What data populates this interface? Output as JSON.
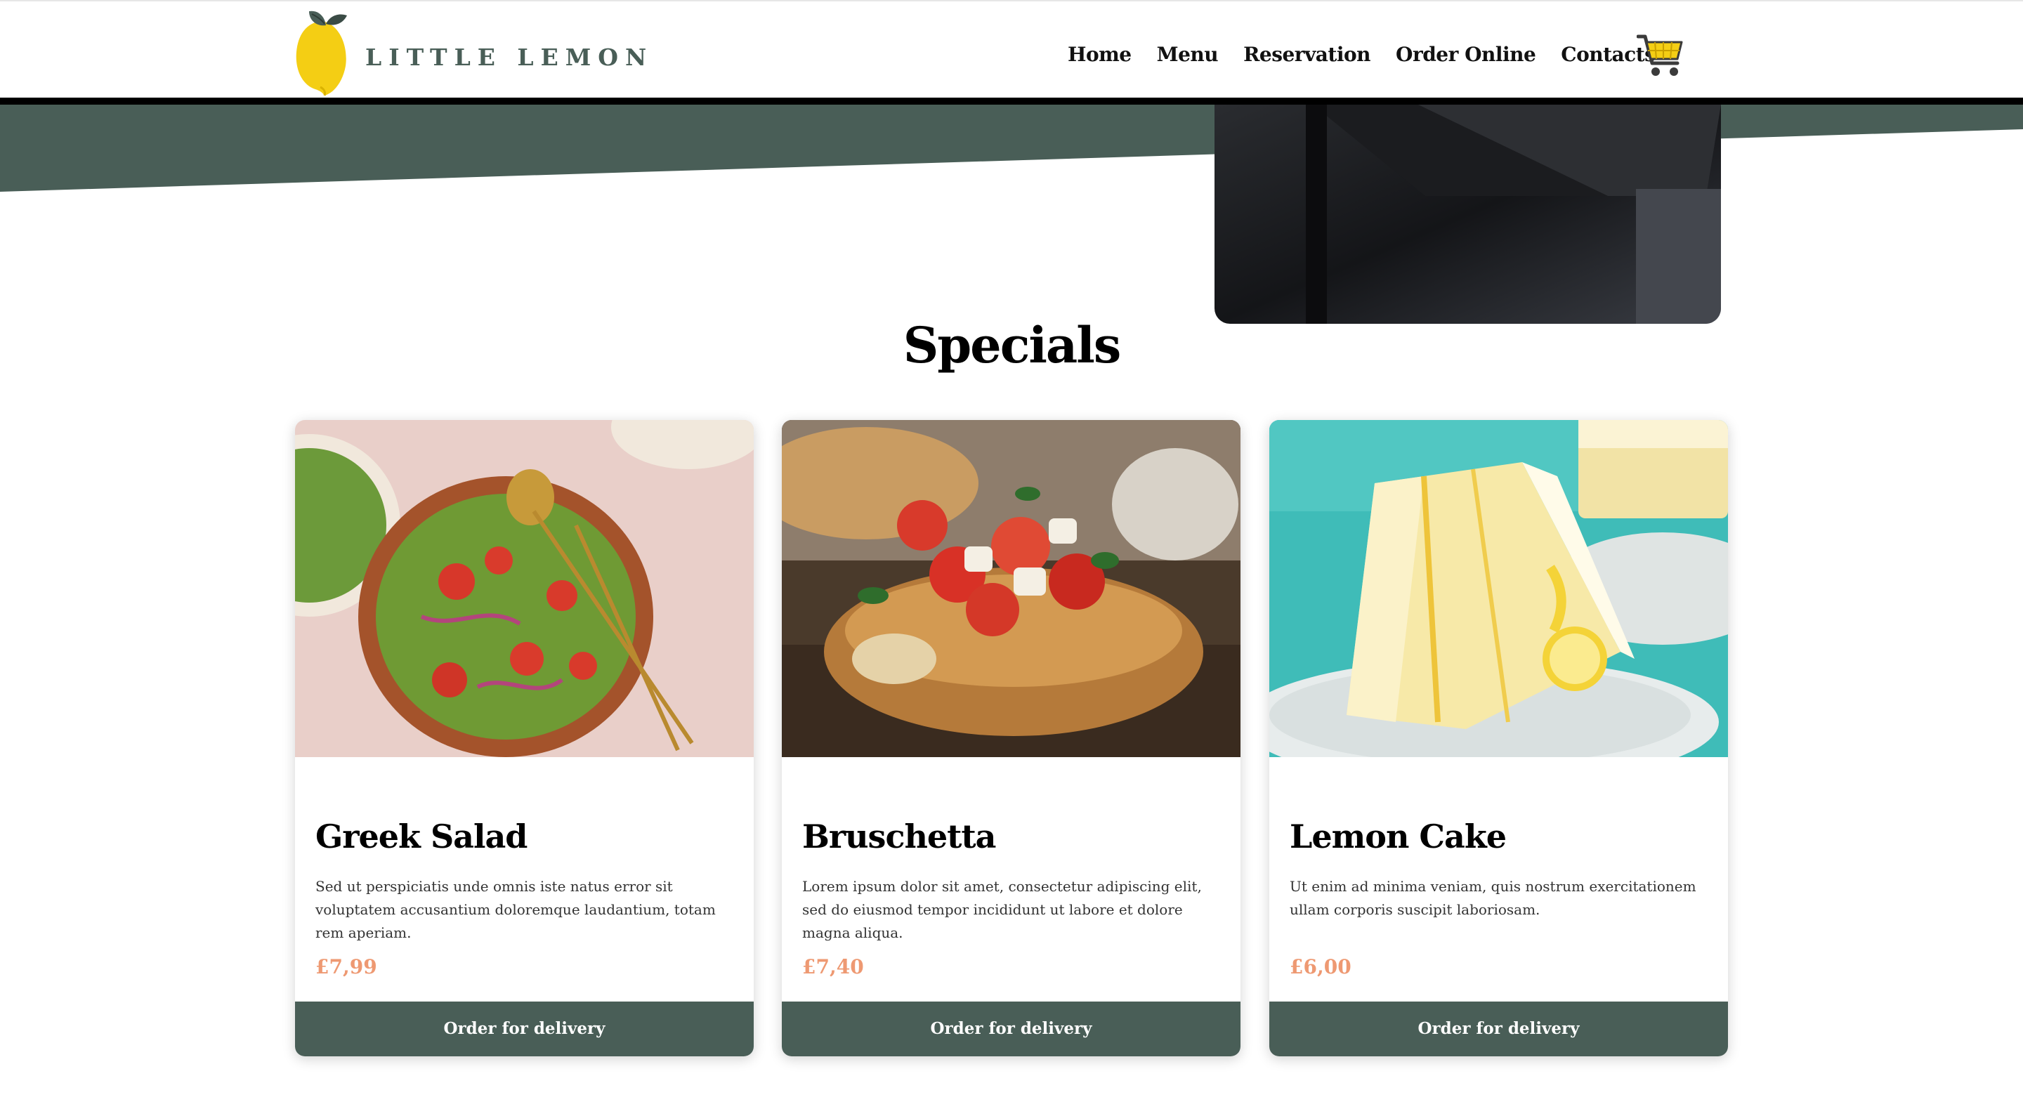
{
  "header": {
    "logo_text": "LITTLE LEMON",
    "nav": [
      {
        "label": "Home"
      },
      {
        "label": "Menu"
      },
      {
        "label": "Reservation"
      },
      {
        "label": "Order Online"
      },
      {
        "label": "Contacts"
      }
    ],
    "cart_icon": "shopping-cart-icon"
  },
  "specials": {
    "title": "Specials",
    "items": [
      {
        "name": "Greek Salad",
        "description": "Sed ut perspiciatis unde omnis iste natus error sit voluptatem accusantium doloremque laudantium, totam rem aperiam.",
        "price": "£7,99",
        "button_label": "Order for delivery"
      },
      {
        "name": "Bruschetta",
        "description": "Lorem ipsum dolor sit amet, consectetur adipiscing elit, sed do eiusmod tempor incididunt ut labore et dolore magna aliqua.",
        "price": "£7,40",
        "button_label": "Order for delivery"
      },
      {
        "name": "Lemon Cake",
        "description": "Ut enim ad minima veniam, quis nostrum exercitationem ullam corporis suscipit laboriosam.",
        "price": "£6,00",
        "button_label": "Order for delivery"
      }
    ]
  },
  "colors": {
    "primary_green": "#495e57",
    "lemon_yellow": "#f4ce14",
    "price_salmon": "#ee9972"
  }
}
